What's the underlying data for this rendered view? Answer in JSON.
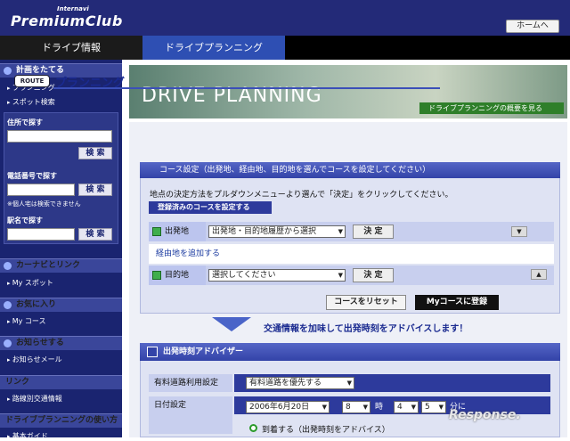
{
  "header": {
    "logo_small": "Internavi",
    "logo": "PremiumClub",
    "home_button": "ホームへ"
  },
  "nav": {
    "tabs": [
      {
        "label": "ドライブ情報"
      },
      {
        "label": "ドライブプランニング"
      }
    ]
  },
  "sidebar": {
    "plan_head": "計画をたてる",
    "plan_items": [
      "プランニング",
      "スポット検索"
    ],
    "address_label": "住所で探す",
    "phone_label": "電話番号で探す",
    "phone_note": "※個人宅は検索できません",
    "station_label": "駅名で探す",
    "search_button": "検 索",
    "carnavi_head": "カーナビとリンク",
    "carnavi_item": "My スポット",
    "fav_head": "お気に入り",
    "fav_item": "My コース",
    "notice_head": "お知らせする",
    "notice_item": "お知らせメール",
    "link_head": "リンク",
    "link_item": "路線別交通情報",
    "guide_head": "ドライブプランニングの使い方",
    "guide_item": "基本ガイド"
  },
  "banner": {
    "title": "DRIVE PLANNING",
    "link": "ドライブプランニングの概要を見る"
  },
  "planning": {
    "route_badge": "ROUTE",
    "title": "プランニング",
    "course_head": "コース設定（出発地、経由地、目的地を選んでコースを設定してください）",
    "desc": "地点の決定方法をプルダウンメニューより選んで「決定」をクリックしてください。",
    "registered_button": "登録済みのコースを設定する",
    "origin_label": "出発地",
    "origin_select": "出発地・目的地履歴から選択",
    "via_link": "経由地を追加する",
    "dest_label": "目的地",
    "dest_select": "選択してください",
    "decide_button": "決 定",
    "reset_button": "コースをリセット",
    "mycourse_button": "Myコースに登録",
    "traffic_text": "交通情報を加味して出発時刻をアドバイスします！"
  },
  "departure": {
    "head": "出発時刻アドバイザー",
    "toll_label": "有料道路利用設定",
    "toll_select": "有料道路を優先する",
    "date_label": "日付設定",
    "date_select": "2006年6月20日",
    "hour_select": "8",
    "hour_unit": "時",
    "min_tens_select": "4",
    "min_ones_select": "5",
    "min_unit": "分に",
    "radio_label": "到着する（出発時刻をアドバイス）"
  },
  "watermark": "Response."
}
